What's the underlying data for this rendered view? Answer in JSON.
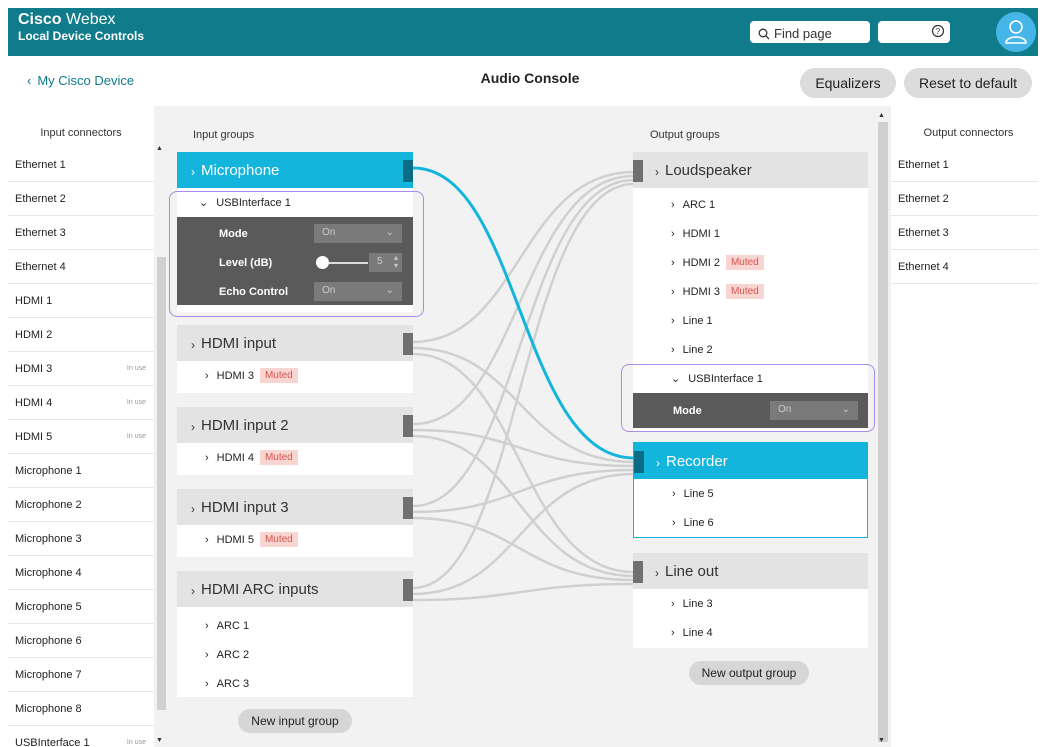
{
  "header": {
    "brand_bold": "Cisco",
    "brand_light": "Webex",
    "subtitle": "Local Device Controls",
    "search_placeholder": "Find page"
  },
  "nav": {
    "back_label": "My Cisco Device",
    "title": "Audio Console",
    "equalizers": "Equalizers",
    "reset": "Reset to default"
  },
  "input_connectors": {
    "title": "Input connectors",
    "in_use_label": "In use",
    "items": [
      {
        "label": "Ethernet 1",
        "in_use": false
      },
      {
        "label": "Ethernet 2",
        "in_use": false
      },
      {
        "label": "Ethernet 3",
        "in_use": false
      },
      {
        "label": "Ethernet 4",
        "in_use": false
      },
      {
        "label": "HDMI 1",
        "in_use": false
      },
      {
        "label": "HDMI 2",
        "in_use": false
      },
      {
        "label": "HDMI 3",
        "in_use": true
      },
      {
        "label": "HDMI 4",
        "in_use": true
      },
      {
        "label": "HDMI 5",
        "in_use": true
      },
      {
        "label": "Microphone 1",
        "in_use": false
      },
      {
        "label": "Microphone 2",
        "in_use": false
      },
      {
        "label": "Microphone 3",
        "in_use": false
      },
      {
        "label": "Microphone 4",
        "in_use": false
      },
      {
        "label": "Microphone 5",
        "in_use": false
      },
      {
        "label": "Microphone 6",
        "in_use": false
      },
      {
        "label": "Microphone 7",
        "in_use": false
      },
      {
        "label": "Microphone 8",
        "in_use": false
      },
      {
        "label": "USBInterface 1",
        "in_use": true
      }
    ]
  },
  "output_connectors": {
    "title": "Output connectors",
    "items": [
      "Ethernet 1",
      "Ethernet 2",
      "Ethernet 3",
      "Ethernet 4"
    ]
  },
  "input_groups": {
    "title": "Input groups",
    "new_label": "New input group",
    "microphone": {
      "name": "Microphone",
      "sub": "USBInterface 1",
      "mode_label": "Mode",
      "mode_value": "On",
      "level_label": "Level (dB)",
      "level_value": "5",
      "echo_label": "Echo Control",
      "echo_value": "On"
    },
    "hdmi_input": {
      "name": "HDMI input",
      "item": "HDMI 3",
      "badge": "Muted"
    },
    "hdmi_input_2": {
      "name": "HDMI input 2",
      "item": "HDMI 4",
      "badge": "Muted"
    },
    "hdmi_input_3": {
      "name": "HDMI input 3",
      "item": "HDMI 5",
      "badge": "Muted"
    },
    "arc_inputs": {
      "name": "HDMI ARC inputs",
      "items": [
        "ARC 1",
        "ARC 2",
        "ARC 3"
      ]
    }
  },
  "output_groups": {
    "title": "Output groups",
    "new_label": "New output group",
    "loudspeaker": {
      "name": "Loudspeaker",
      "items": [
        {
          "label": "ARC 1",
          "badge": ""
        },
        {
          "label": "HDMI 1",
          "badge": ""
        },
        {
          "label": "HDMI 2",
          "badge": "Muted"
        },
        {
          "label": "HDMI 3",
          "badge": "Muted"
        },
        {
          "label": "Line 1",
          "badge": ""
        },
        {
          "label": "Line 2",
          "badge": ""
        }
      ],
      "sub": "USBInterface 1",
      "mode_label": "Mode",
      "mode_value": "On"
    },
    "recorder": {
      "name": "Recorder",
      "items": [
        "Line 5",
        "Line 6"
      ]
    },
    "line_out": {
      "name": "Line out",
      "items": [
        "Line 3",
        "Line 4"
      ]
    }
  },
  "colors": {
    "header": "#107b8a",
    "active": "#13b5dd",
    "highlight": "#a98ce6",
    "muted_bg": "#f9d5d2"
  }
}
